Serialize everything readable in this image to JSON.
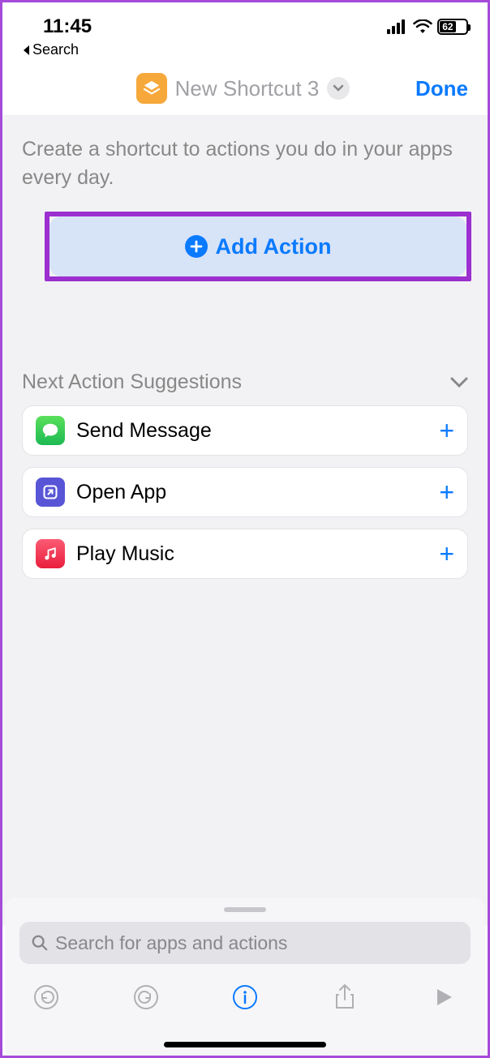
{
  "status": {
    "time": "11:45",
    "battery": "62"
  },
  "back": {
    "label": "Search"
  },
  "nav": {
    "title": "New Shortcut 3",
    "done": "Done"
  },
  "intro": "Create a shortcut to actions you do in your apps every day.",
  "add_action": "Add Action",
  "suggestions_header": "Next Action Suggestions",
  "suggestions": [
    {
      "label": "Send Message"
    },
    {
      "label": "Open App"
    },
    {
      "label": "Play Music"
    }
  ],
  "search": {
    "placeholder": "Search for apps and actions"
  }
}
